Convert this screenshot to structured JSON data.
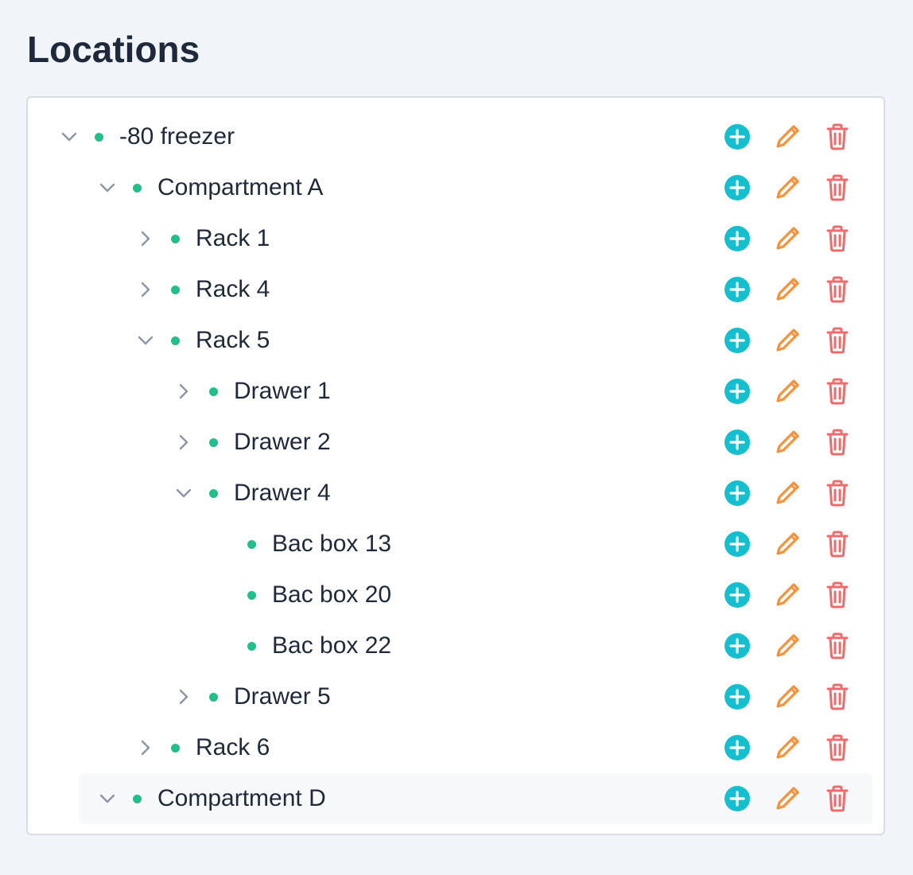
{
  "page": {
    "title": "Locations"
  },
  "icons": {
    "expand": "chevron-down-icon",
    "collapse": "chevron-right-icon",
    "add": "plus-circle-icon",
    "edit": "pencil-icon",
    "delete": "trash-icon"
  },
  "colors": {
    "dot": "#1fbf8a",
    "add": "#14bfcf",
    "edit": "#f7913a",
    "delete": "#ef6b6b",
    "chevron": "#8a96a8"
  },
  "tree": [
    {
      "label": "-80 freezer",
      "depth": 0,
      "toggle": "expanded"
    },
    {
      "label": "Compartment A",
      "depth": 1,
      "toggle": "expanded"
    },
    {
      "label": "Rack 1",
      "depth": 2,
      "toggle": "collapsed"
    },
    {
      "label": "Rack 4",
      "depth": 2,
      "toggle": "collapsed"
    },
    {
      "label": "Rack 5",
      "depth": 2,
      "toggle": "expanded"
    },
    {
      "label": "Drawer 1",
      "depth": 3,
      "toggle": "collapsed"
    },
    {
      "label": "Drawer 2",
      "depth": 3,
      "toggle": "collapsed"
    },
    {
      "label": "Drawer 4",
      "depth": 3,
      "toggle": "expanded"
    },
    {
      "label": "Bac box 13",
      "depth": 4,
      "toggle": "none"
    },
    {
      "label": "Bac box 20",
      "depth": 4,
      "toggle": "none"
    },
    {
      "label": "Bac box 22",
      "depth": 4,
      "toggle": "none"
    },
    {
      "label": "Drawer 5",
      "depth": 3,
      "toggle": "collapsed"
    },
    {
      "label": "Rack 6",
      "depth": 2,
      "toggle": "collapsed"
    },
    {
      "label": "Compartment D",
      "depth": 1,
      "toggle": "expanded",
      "hovered": true
    }
  ]
}
